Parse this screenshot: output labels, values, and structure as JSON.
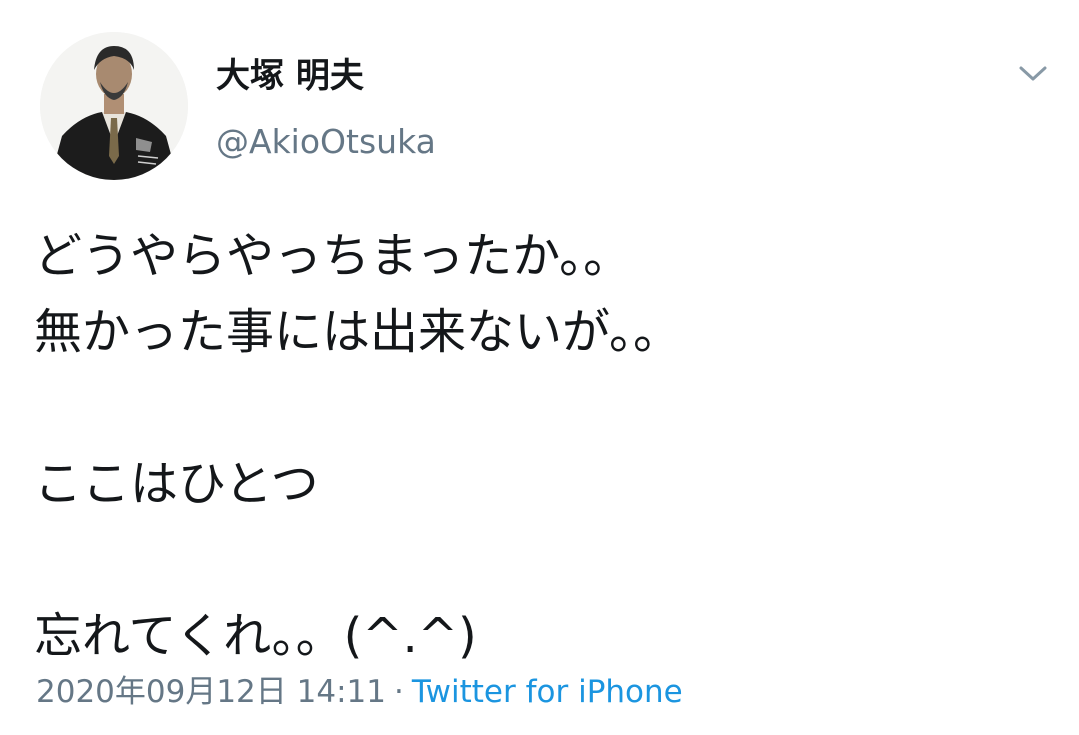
{
  "tweet": {
    "author": {
      "display_name": "大塚 明夫",
      "handle": "@AkioOtsuka",
      "avatar_icon": "avatar-portrait-icon"
    },
    "menu_icon": "chevron-down-icon",
    "text_lines": [
      "どうやらやっちまったか。。",
      "無かった事には出来ないが。。",
      "",
      "ここはひとつ",
      "",
      "忘れてくれ。。(^.^)"
    ],
    "timestamp": "2020年09月12日 14:11",
    "separator": "·",
    "source": "Twitter for iPhone"
  },
  "colors": {
    "text": "#14171a",
    "secondary": "#657786",
    "link": "#1b95e0",
    "background": "#ffffff"
  }
}
